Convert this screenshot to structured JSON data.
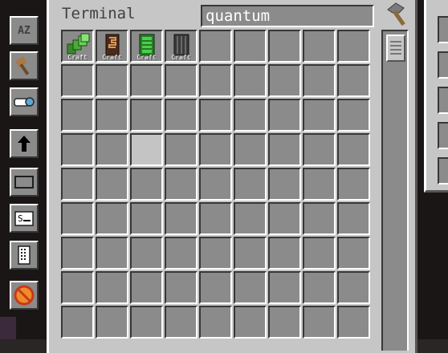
{
  "terminal": {
    "title": "Terminal",
    "search_value": "quantum",
    "grid_columns": 9,
    "grid_rows": 9,
    "highlighted_slot": {
      "row": 3,
      "col": 2
    },
    "items": [
      {
        "name": "quantum-ring-icon",
        "label": "Craft"
      },
      {
        "name": "quantum-link-chamber-icon",
        "label": "Craft"
      },
      {
        "name": "quantum-entangled-singularity-icon",
        "label": "Craft"
      },
      {
        "name": "quantum-storage-icon",
        "label": "Craft"
      }
    ]
  },
  "toolbar": {
    "sort_label": "AZ",
    "buttons": [
      "sort-az-button",
      "view-mode-button",
      "search-mode-button",
      "sort-direction-button",
      "terminal-style-button",
      "search-box-mode-button",
      "crafting-status-button",
      "clear-button"
    ]
  },
  "colors": {
    "panel": "#c6c6c6",
    "slot": "#8b8b8b",
    "highlight": "#c4c4c4",
    "text": "#404040"
  }
}
